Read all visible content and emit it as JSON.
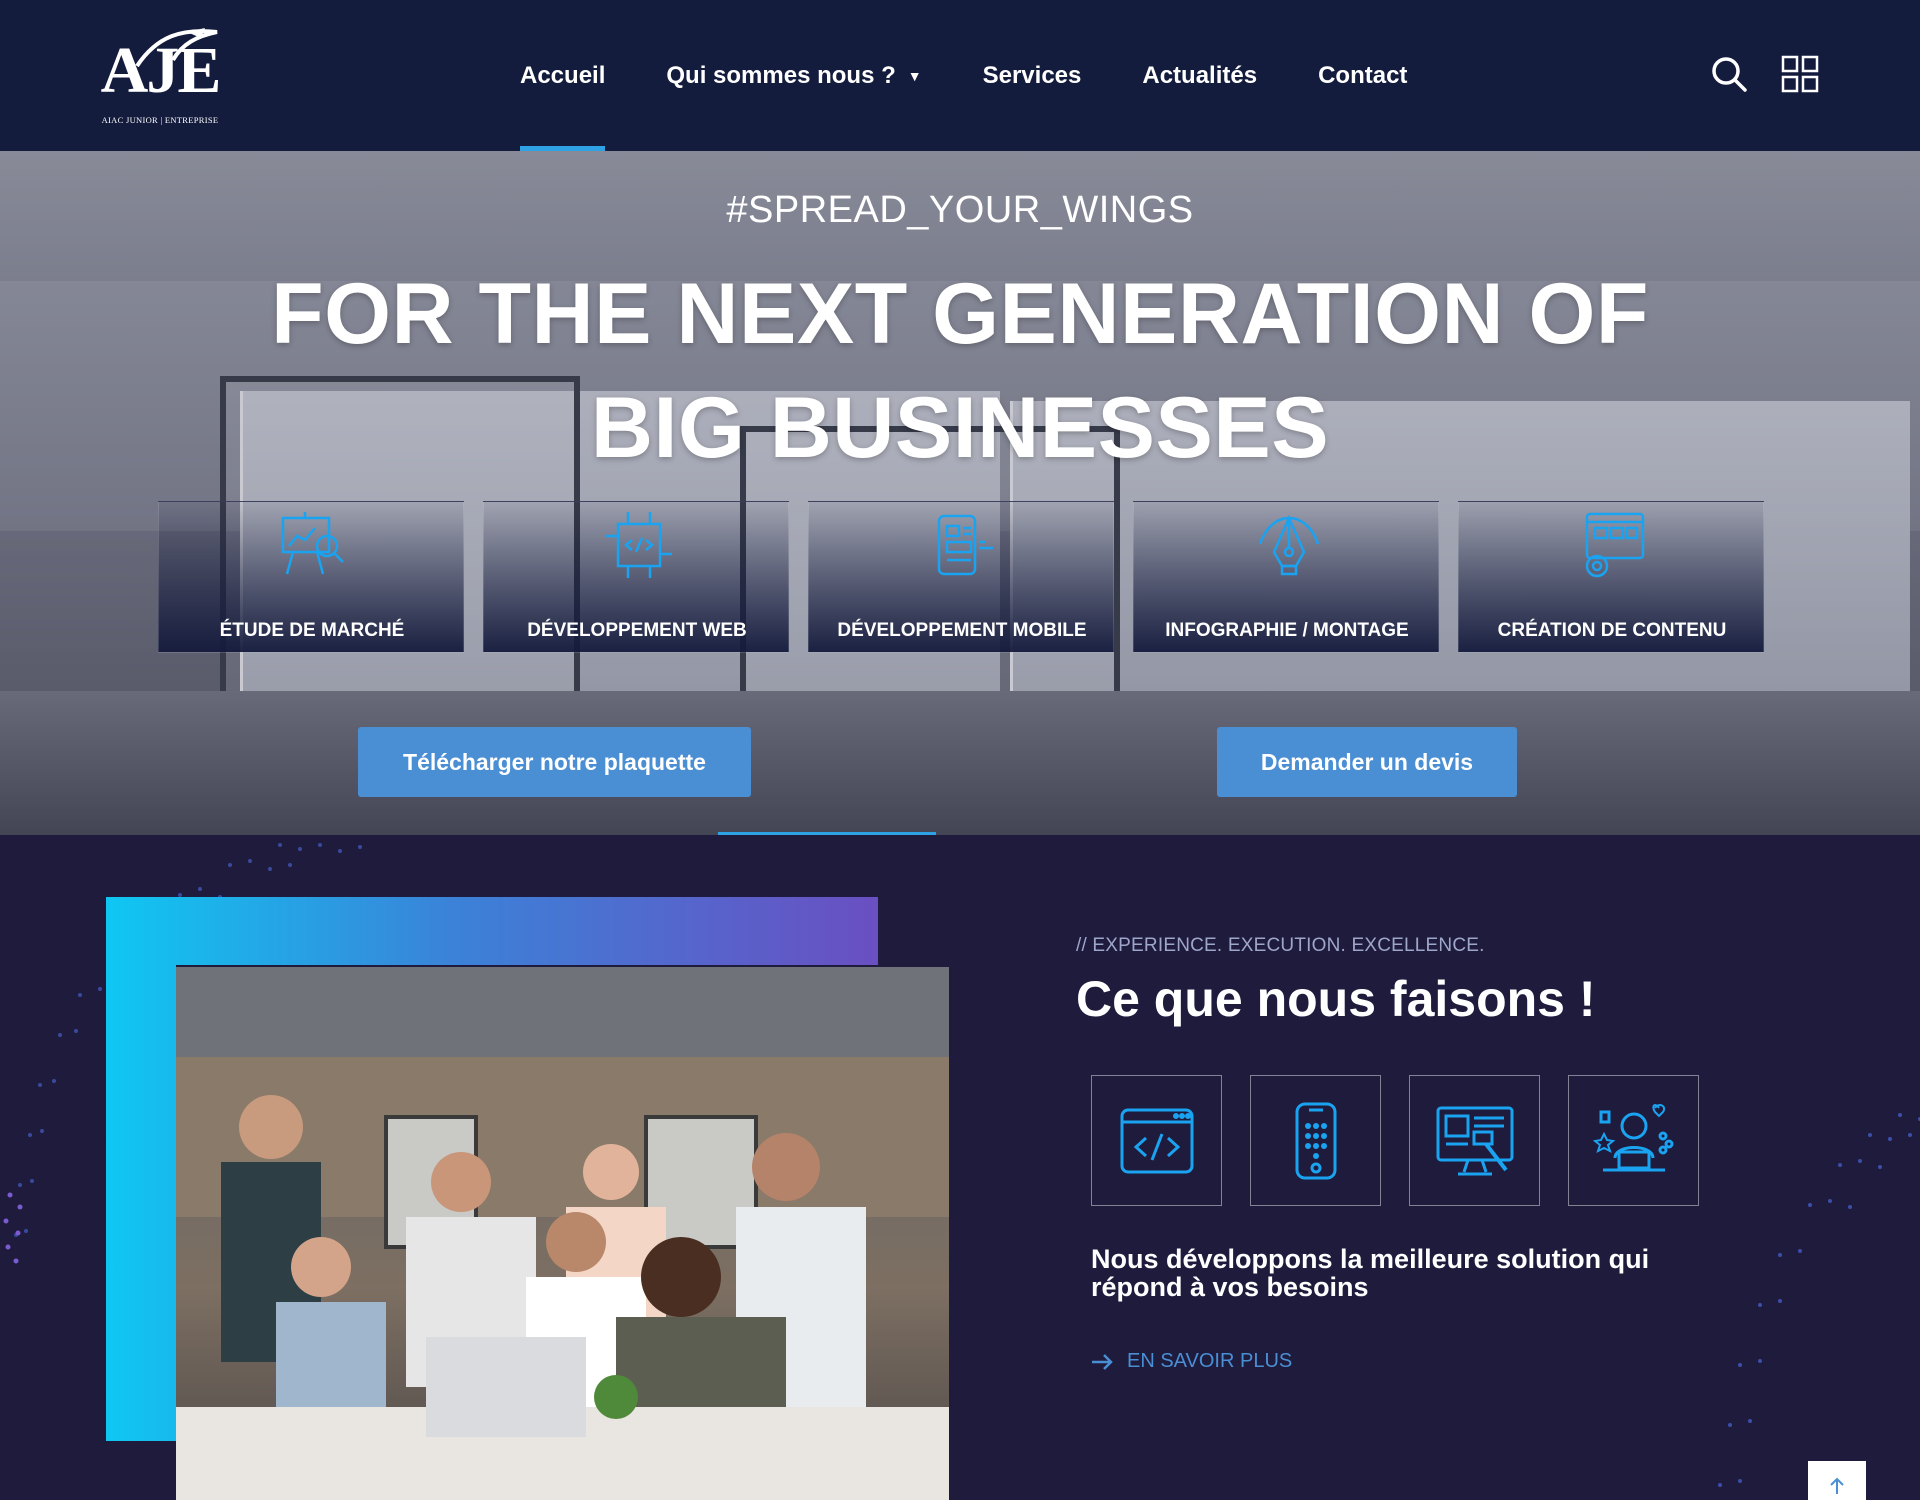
{
  "brand": {
    "logo_text": "AJE",
    "logo_sub_left": "AIAC JUNIOR",
    "logo_sub_right": "ENTREPRISE"
  },
  "nav": {
    "items": [
      {
        "label": "Accueil",
        "active": true
      },
      {
        "label": "Qui sommes nous ?",
        "has_dropdown": true
      },
      {
        "label": "Services"
      },
      {
        "label": "Actualités"
      },
      {
        "label": "Contact"
      }
    ],
    "dropdown_caret": "▼"
  },
  "header_icons": [
    "search-icon",
    "grid-menu-icon"
  ],
  "hero": {
    "tagline": "#SPREAD_YOUR_WINGS",
    "headline_line1": "FOR THE NEXT GENERATION OF",
    "headline_line2": "BIG BUSINESSES",
    "services": [
      {
        "label": "ÉTUDE DE MARCHÉ",
        "icon": "market-study-icon"
      },
      {
        "label": "DÉVELOPPEMENT WEB",
        "icon": "web-dev-icon"
      },
      {
        "label": "DÉVELOPPEMENT MOBILE",
        "icon": "mobile-dev-icon"
      },
      {
        "label": "INFOGRAPHIE / MONTAGE",
        "icon": "pen-tool-icon"
      },
      {
        "label": "CRÉATION DE CONTENU",
        "icon": "content-creation-icon"
      }
    ],
    "buttons": {
      "brochure": "Télécharger notre plaquette",
      "quote": "Demander un devis"
    }
  },
  "about": {
    "kicker": "// EXPERIENCE. EXECUTION. EXCELLENCE.",
    "title": "Ce que nous faisons !",
    "tiles": [
      "code-window-icon",
      "mobile-keypad-icon",
      "monitor-design-icon",
      "social-user-icon"
    ],
    "description": "Nous développons la meilleure solution qui répond à vos besoins",
    "link_label": "EN SAVOIR PLUS"
  },
  "colors": {
    "header_bg": "#141c3e",
    "section_bg": "#1e1b3d",
    "accent": "#2fa2e6",
    "button": "#4a8ed4",
    "icon_blue": "#1aa3f0"
  }
}
